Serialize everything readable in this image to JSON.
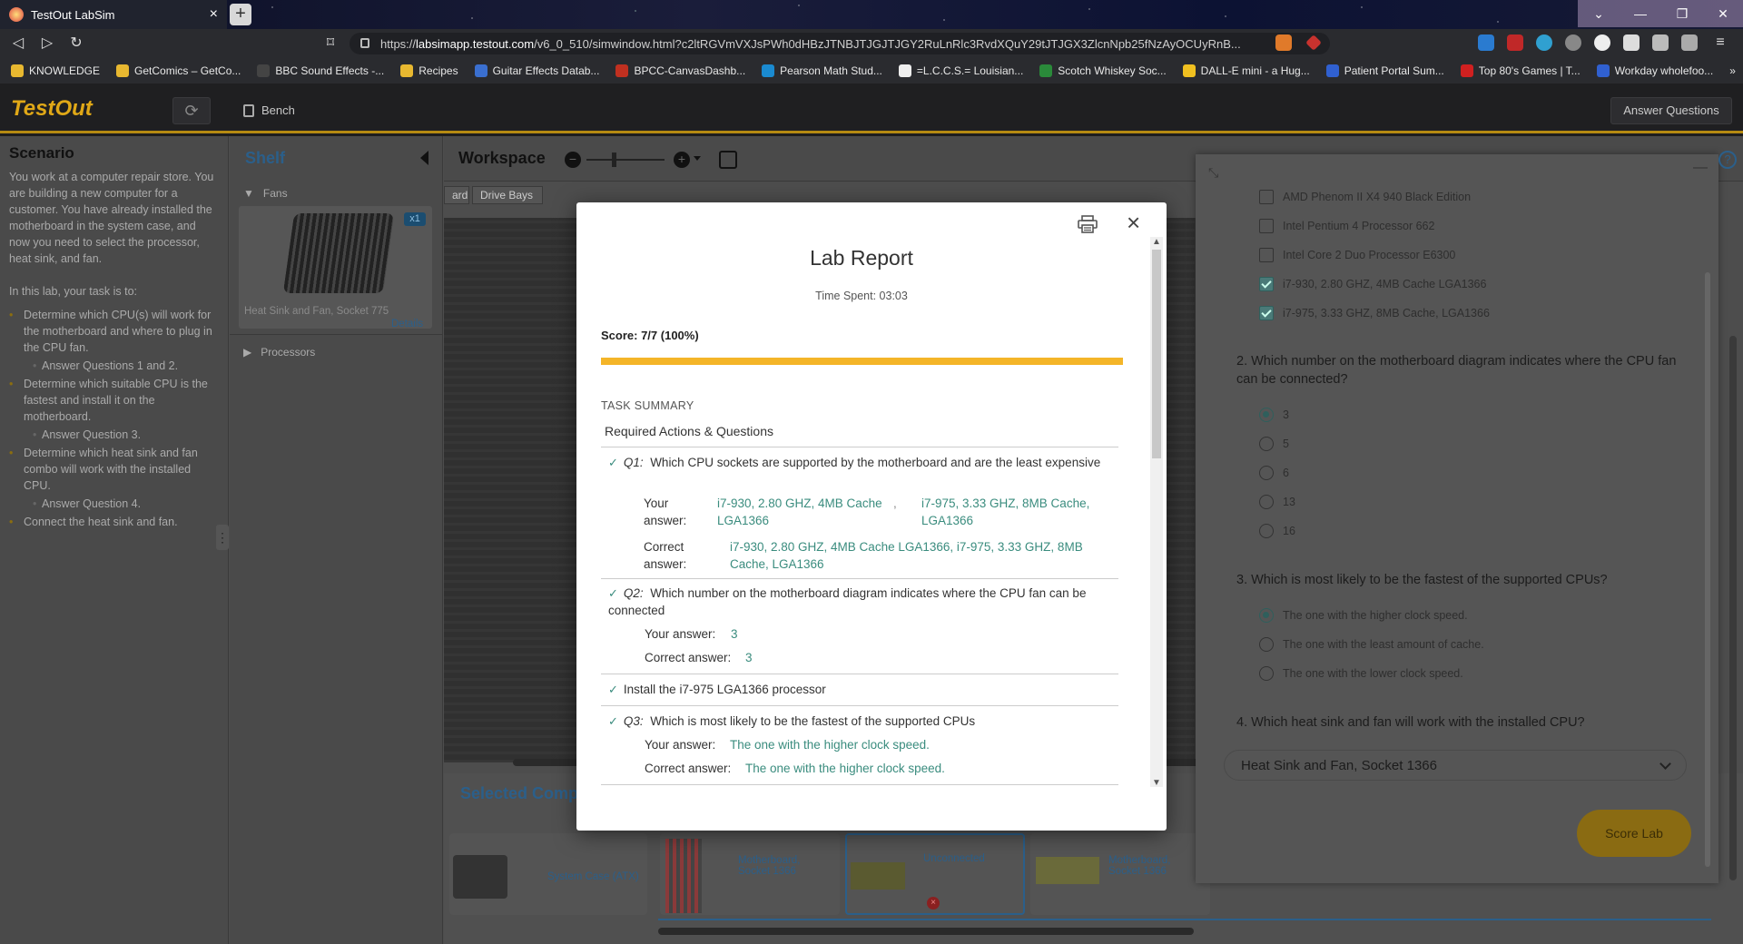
{
  "browser": {
    "tab_title": "TestOut LabSim",
    "tab_close": "×",
    "new_tab": "+",
    "url_prefix": "https://",
    "url_host": "labsimapp.testout.com",
    "url_path": "/v6_0_510/simwindow.html?c2ltRGVmVXJsPWh0dHBzJTNBJTJGJTJGY2RuLnRlc3RvdXQuY29tJTJGX3ZlcnNpb25fNzAyOCUyRnB...",
    "bookmarks": [
      "KNOWLEDGE",
      "GetComics – GetCo...",
      "BBC Sound Effects -...",
      "Recipes",
      "Guitar Effects Datab...",
      "BPCC-CanvasDashb...",
      "Pearson Math Stud...",
      "=L.C.C.S.= Louisian...",
      "Scotch Whiskey Soc...",
      "DALL-E mini - a Hug...",
      "Patient Portal Sum...",
      "Top 80's Games | T...",
      "Workday wholefoo..."
    ],
    "bookmark_colors": [
      "#e8b830",
      "#e8b830",
      "#444",
      "#e8b830",
      "#3a6fd0",
      "#c03020",
      "#1a8ad0",
      "#eee",
      "#2a8a3a",
      "#f0c020",
      "#3060d0",
      "#d02020",
      "#3060d0"
    ]
  },
  "app": {
    "logo": "TestOut",
    "bench_label": "Bench",
    "answer_questions_label": "Answer Questions"
  },
  "scenario": {
    "title": "Scenario",
    "intro": "You work at a computer repair store. You are building a new computer for a customer. You have already installed the motherboard in the system case, and now you need to select the processor, heat sink, and fan.",
    "task_intro": "In this lab, your task is to:",
    "tasks": [
      {
        "text": "Determine which CPU(s) will work for the motherboard and where to plug in the CPU fan.",
        "sub": "Answer Questions 1 and 2."
      },
      {
        "text": "Determine which suitable CPU is the fastest and install it on the motherboard.",
        "sub": "Answer Question 3."
      },
      {
        "text": "Determine which heat sink and fan combo will work with the installed CPU.",
        "sub": "Answer Question 4."
      },
      {
        "text": "Connect the heat sink and fan.",
        "sub": ""
      }
    ]
  },
  "shelf": {
    "title": "Shelf",
    "category_fans": "Fans",
    "item_name": "Heat Sink and Fan, Socket 775",
    "item_count": "x1",
    "item_details": "Details",
    "category_processors": "Processors"
  },
  "workspace": {
    "title": "Workspace",
    "tabs": [
      "ard",
      "Drive Bays"
    ],
    "selected_title": "Selected Comp",
    "components": [
      "System Case (ATX)",
      "Motherboard, Socket 1366",
      "Unconnected",
      "Motherboard, Socket 1366"
    ]
  },
  "questions": {
    "q1_options": [
      {
        "label": "AMD Phenom II X4 940 Black Edition",
        "checked": false
      },
      {
        "label": "Intel Pentium 4 Processor 662",
        "checked": false
      },
      {
        "label": "Intel Core 2 Duo Processor E6300",
        "checked": false
      },
      {
        "label": "i7-930, 2.80 GHZ, 4MB Cache LGA1366",
        "checked": true
      },
      {
        "label": "i7-975, 3.33 GHZ, 8MB Cache, LGA1366",
        "checked": true
      }
    ],
    "q2_text": "2. Which number on the motherboard diagram indicates where the CPU fan can be connected?",
    "q2_options": [
      {
        "label": "3",
        "selected": true
      },
      {
        "label": "5",
        "selected": false
      },
      {
        "label": "6",
        "selected": false
      },
      {
        "label": "13",
        "selected": false
      },
      {
        "label": "16",
        "selected": false
      }
    ],
    "q3_text": "3. Which is most likely to be the fastest of the supported CPUs?",
    "q3_options": [
      {
        "label": "The one with the higher clock speed.",
        "selected": true
      },
      {
        "label": "The one with the least amount of cache.",
        "selected": false
      },
      {
        "label": "The one with the lower clock speed.",
        "selected": false
      }
    ],
    "q4_text": "4. Which heat sink and fan will work with the installed CPU?",
    "q4_value": "Heat Sink and Fan, Socket 1366",
    "score_button": "Score Lab",
    "help": "?"
  },
  "report": {
    "title": "Lab Report",
    "time_spent": "Time Spent: 03:03",
    "score": "Score: 7/7 (100%)",
    "score_fraction": 1.0,
    "task_summary": "TASK SUMMARY",
    "required_header": "Required Actions & Questions",
    "close": "×",
    "check": "✓",
    "q1": {
      "prefix": "Q1:",
      "text": "Which CPU sockets are supported by the motherboard and are the least expensive",
      "your_label": "Your answer:",
      "your_value_1": "i7-930, 2.80 GHZ, 4MB Cache LGA1366",
      "your_value_sep": ",",
      "your_value_2": "i7-975, 3.33 GHZ, 8MB Cache, LGA1366",
      "correct_label": "Correct answer:",
      "correct_value": "i7-930, 2.80 GHZ, 4MB Cache LGA1366, i7-975, 3.33 GHZ, 8MB Cache, LGA1366"
    },
    "q2": {
      "prefix": "Q2:",
      "text": "Which number on the motherboard diagram indicates where the CPU fan can be connected",
      "your_label": "Your answer:",
      "your_value": "3",
      "correct_label": "Correct answer:",
      "correct_value": "3"
    },
    "action_install": "Install the i7-975 LGA1366 processor",
    "q3": {
      "prefix": "Q3:",
      "text": "Which is most likely to be the fastest of the supported CPUs",
      "your_label": "Your answer:",
      "your_value": "The one with the higher clock speed.",
      "correct_label": "Correct answer:",
      "correct_value": "The one with the higher clock speed."
    }
  }
}
